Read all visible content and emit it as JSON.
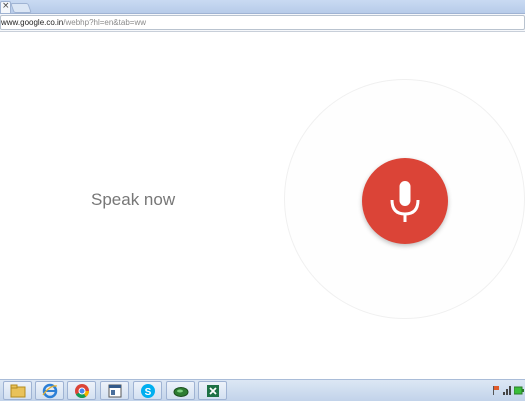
{
  "browser": {
    "tab_close_glyph": "×",
    "address": {
      "host": "www.google.co.in",
      "path": "/webhp?hl=en&tab=ww"
    }
  },
  "voice_search": {
    "prompt": "Speak now",
    "mic_color": "#db4437",
    "icon": "microphone-icon"
  },
  "taskbar": {
    "items": [
      {
        "icon": "folder-icon"
      },
      {
        "icon": "internet-explorer-icon"
      },
      {
        "icon": "chrome-icon"
      },
      {
        "icon": "window-icon"
      },
      {
        "icon": "skype-icon"
      },
      {
        "icon": "green-oval-app-icon"
      },
      {
        "icon": "excel-icon"
      }
    ],
    "tray": [
      "flag-icon",
      "network-icon",
      "battery-icon"
    ]
  }
}
